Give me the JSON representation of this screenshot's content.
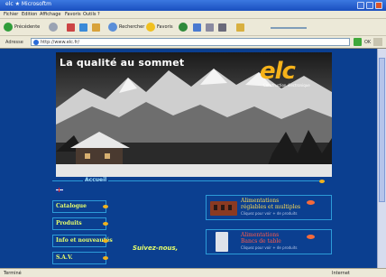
{
  "window": {
    "title": "elc ★ Microsoftm",
    "menu": [
      "Fichier",
      "Edition",
      "Affichage",
      "Favoris",
      "Outils",
      "?"
    ],
    "toolbar": {
      "back": "Précédente",
      "search": "Rechercher",
      "favorites": "Favoris"
    },
    "address": {
      "label": "Adresse",
      "url": "http://www.elc.fr/",
      "go": "OK"
    },
    "status": {
      "left": "Terminé",
      "right": "Internet"
    }
  },
  "page": {
    "slogan": "La qualité au sommet",
    "logo": "elc",
    "logo_sub": "Construction électronique",
    "accueil": "Accueil",
    "nav": [
      "Catalogue",
      "Produits",
      "Info et nouveautés",
      "S.A.V."
    ],
    "follow": "Suivez-nous,",
    "products": [
      {
        "name": "Alimentations",
        "sub": "réglables et multiples",
        "more": "Cliquez pour voir + de produits"
      },
      {
        "name": "Alimentations",
        "sub": "Bancs de table",
        "more": "Cliquez pour voir + de produits"
      }
    ]
  },
  "colors": {
    "background": "#0b3f90",
    "nav_text": "#e8ff6b",
    "logo": "#f5b21a",
    "accent_dot": "#f0b21f",
    "border": "#2c9bd8"
  }
}
